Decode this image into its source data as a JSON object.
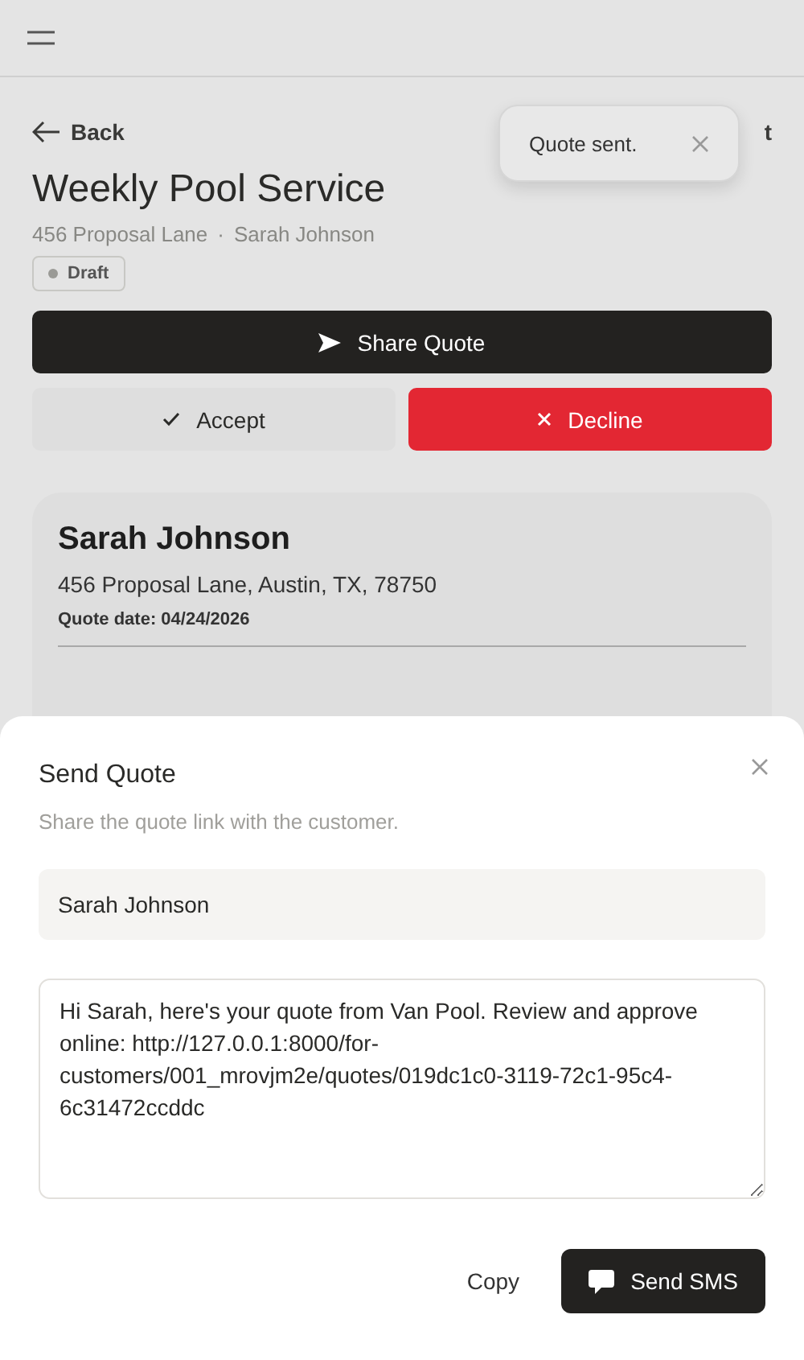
{
  "nav": {
    "back": "Back",
    "action_fragment": "t"
  },
  "toast": {
    "message": "Quote sent."
  },
  "quote": {
    "title": "Weekly Pool Service",
    "address": "456 Proposal Lane",
    "separator": "·",
    "customer": "Sarah Johnson",
    "status": {
      "label": "Draft",
      "color": "#9a9a96"
    }
  },
  "actions": [
    {
      "kind": "share",
      "label": "Share Quote"
    },
    {
      "kind": "accept",
      "label": "Accept"
    },
    {
      "kind": "decline",
      "label": "Decline"
    }
  ],
  "customer_card": {
    "name": "Sarah Johnson",
    "address": "456 Proposal Lane, Austin, TX, 78750",
    "quote_date": "Quote date: 04/24/2026"
  },
  "dialog": {
    "title": "Send Quote",
    "description": "Share the quote link with the customer.",
    "recipient": "Sarah Johnson",
    "message": "Hi Sarah, here's your quote from Van Pool. Review and approve online: http://127.0.0.1:8000/for-customers/001_mrovjm2e/quotes/019dc1c0-3119-72c1-95c4-6c31472ccddc",
    "buttons": [
      {
        "kind": "link",
        "label": "Copy"
      },
      {
        "kind": "primary",
        "label": "Send SMS"
      }
    ]
  }
}
